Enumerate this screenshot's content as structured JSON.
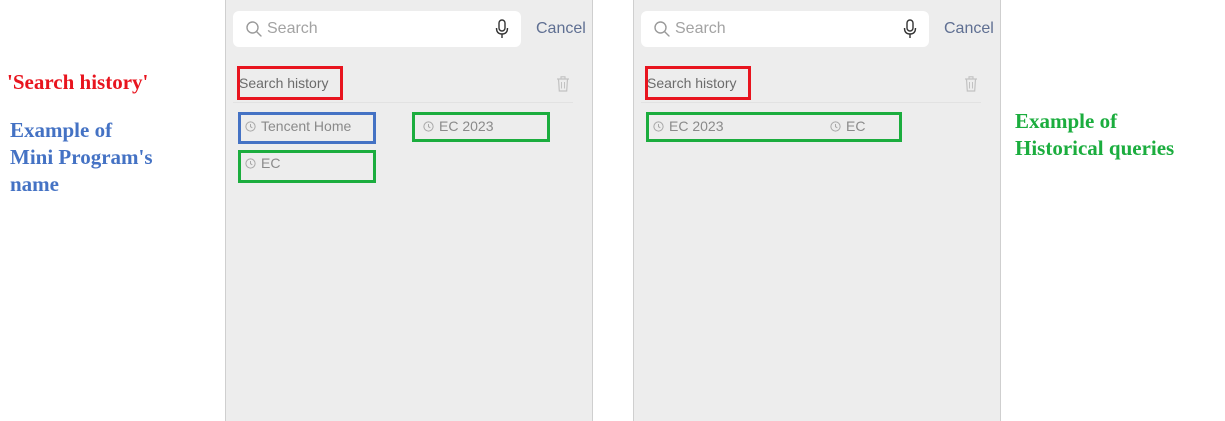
{
  "annotations": {
    "search_history": "'Search history'",
    "mini_program": [
      "Example of",
      "Mini Program's",
      "name"
    ],
    "historical_queries": [
      "Example of",
      "Historical queries"
    ]
  },
  "panels": [
    {
      "search_placeholder": "Search",
      "cancel_label": "Cancel",
      "history_title": "Search history",
      "items": [
        "Tencent Home",
        "EC 2023",
        "EC"
      ]
    },
    {
      "search_placeholder": "Search",
      "cancel_label": "Cancel",
      "history_title": "Search history",
      "items": [
        "EC 2023",
        "EC"
      ]
    }
  ],
  "colors": {
    "highlight_title": "#e8141e",
    "highlight_mini_program": "#4472c4",
    "highlight_query": "#1bad3e"
  },
  "icons": [
    "search-icon",
    "microphone-icon",
    "trash-icon",
    "clock-icon"
  ]
}
